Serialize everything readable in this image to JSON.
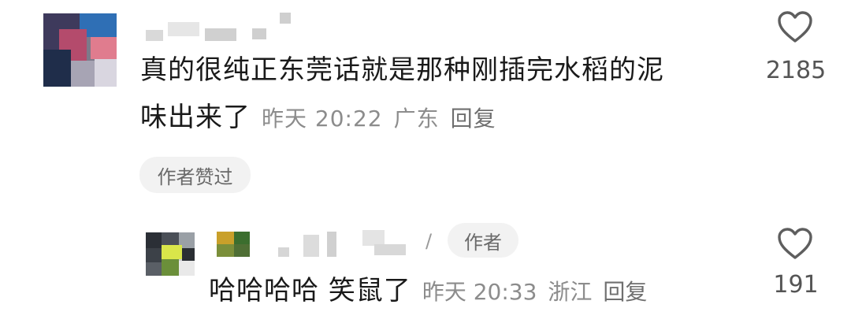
{
  "comment": {
    "text_line1": "真的很纯正东莞话就是那种刚插完水稻的泥",
    "text_line2": "味出来了",
    "time": "昨天 20:22",
    "location": "广东",
    "reply_label": "回复",
    "like_count": "2185",
    "author_liked_badge": "作者赞过"
  },
  "reply": {
    "separator": "/",
    "author_badge": "作者",
    "text": "哈哈哈哈 笑鼠了",
    "time": "昨天 20:33",
    "location": "浙江",
    "reply_label": "回复",
    "like_count": "191"
  },
  "icons": {
    "like": "heart-outline-icon"
  },
  "colors": {
    "text": "#1a1a1a",
    "meta": "#8c8c8c",
    "badge_bg": "#f2f2f2"
  }
}
